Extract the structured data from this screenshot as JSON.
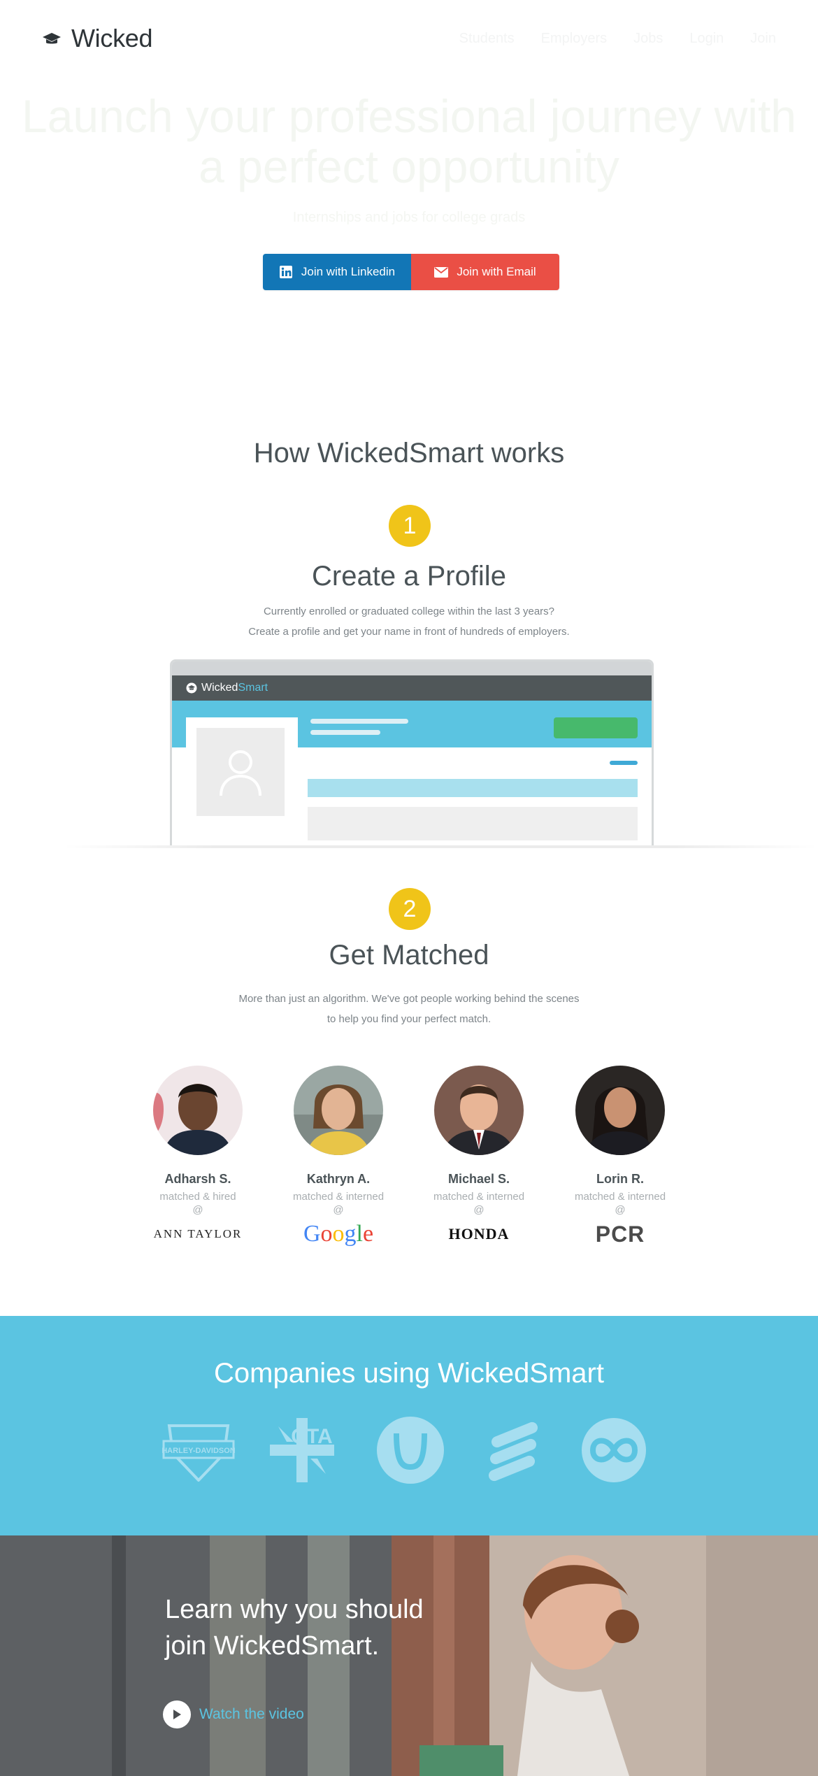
{
  "header": {
    "logo_text": "Wicked",
    "nav": [
      "Students",
      "Employers",
      "Jobs",
      "Login",
      "Join"
    ]
  },
  "hero": {
    "title_line1": "Launch your professional journey with",
    "title_line2": "a perfect opportunity",
    "subtitle": "Internships and jobs for college grads",
    "linkedin_button": "Join with Linkedin",
    "email_button": "Join with Email"
  },
  "how": {
    "title": "How WickedSmart works",
    "step1": {
      "number": "1",
      "title": "Create a Profile",
      "line1": "Currently enrolled or graduated college within the last 3 years?",
      "line2": "Create a profile and get your name in front of hundreds of employers."
    },
    "mockup": {
      "logo_wicked": "Wicked",
      "logo_smart": "Smart"
    },
    "step2": {
      "number": "2",
      "title": "Get Matched",
      "line1": "More than just an algorithm. We've got people working behind the scenes",
      "line2": "to help you find your perfect match."
    }
  },
  "people": [
    {
      "name": "Adharsh S.",
      "status": "matched & hired",
      "at": "@",
      "company": "ANN TAYLOR"
    },
    {
      "name": "Kathryn A.",
      "status": "matched & interned",
      "at": "@",
      "company": "Google"
    },
    {
      "name": "Michael S.",
      "status": "matched & interned",
      "at": "@",
      "company": "HONDA"
    },
    {
      "name": "Lorin R.",
      "status": "matched & interned",
      "at": "@",
      "company": "PCR"
    }
  ],
  "companies": {
    "title": "Companies using WickedSmart",
    "logos": [
      "harley-davidson-logo",
      "cta-logo",
      "herman-miller-logo",
      "ericsson-logo",
      "infinity-logo"
    ],
    "harley_text": "HARLEY-DAVIDSON",
    "cta_text": "CTA"
  },
  "video": {
    "line1": "Learn why you should",
    "line2": "join WickedSmart.",
    "cta": "Watch the video"
  },
  "colors": {
    "accent": "#5bc4e1",
    "step": "#f0c419",
    "linkedin": "#1276b6",
    "email": "#ea4f45"
  }
}
